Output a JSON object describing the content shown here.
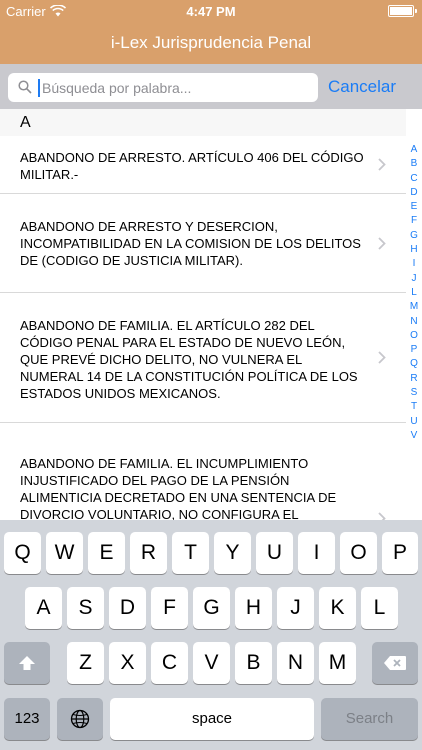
{
  "status_bar": {
    "carrier": "Carrier",
    "time": "4:47 PM"
  },
  "nav": {
    "title": "i-Lex Jurisprudencia Penal"
  },
  "search": {
    "placeholder": "Búsqueda por palabra...",
    "value": "",
    "cancel_label": "Cancelar"
  },
  "section": {
    "letter": "A"
  },
  "items": [
    {
      "text": "ABANDONO DE ARRESTO. ARTÍCULO 406 DEL CÓDIGO MILITAR.-"
    },
    {
      "text": "ABANDONO DE ARRESTO Y DESERCION, INCOMPATIBILIDAD EN LA COMISION DE LOS DELITOS DE (CODIGO DE JUSTICIA MILITAR)."
    },
    {
      "text": "ABANDONO DE FAMILIA. EL ARTÍCULO 282 DEL CÓDIGO PENAL PARA EL ESTADO DE NUEVO LEÓN, QUE PREVÉ DICHO DELITO, NO VULNERA EL NUMERAL 14 DE LA CONSTITUCIÓN POLÍTICA DE LOS ESTADOS UNIDOS MEXICANOS."
    },
    {
      "text": "ABANDONO DE FAMILIA. EL INCUMPLIMIENTO INJUSTIFICADO DEL PAGO DE LA PENSIÓN ALIMENTICIA DECRETADO EN UNA SENTENCIA DE DIVORCIO VOLUNTARIO, NO CONFIGURA EL"
    }
  ],
  "index": [
    "A",
    "B",
    "C",
    "D",
    "E",
    "F",
    "G",
    "H",
    "I",
    "J",
    "L",
    "M",
    "N",
    "O",
    "P",
    "Q",
    "R",
    "S",
    "T",
    "U",
    "V"
  ],
  "keyboard": {
    "row1": [
      "Q",
      "W",
      "E",
      "R",
      "T",
      "Y",
      "U",
      "I",
      "O",
      "P"
    ],
    "row2": [
      "A",
      "S",
      "D",
      "F",
      "G",
      "H",
      "J",
      "K",
      "L"
    ],
    "row3": [
      "Z",
      "X",
      "C",
      "V",
      "B",
      "N",
      "M"
    ],
    "numbers_label": "123",
    "space_label": "space",
    "search_label": "Search"
  }
}
